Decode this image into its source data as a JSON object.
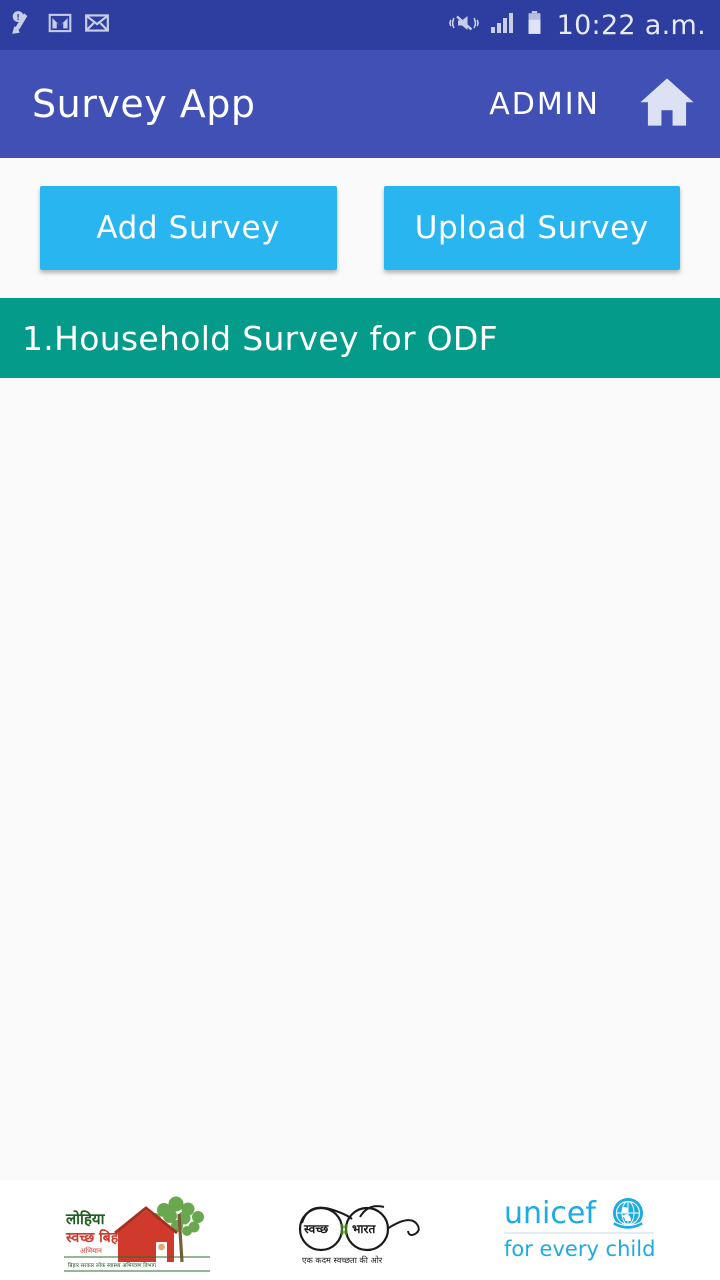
{
  "status_bar": {
    "background": "#2e3ea0",
    "clock": "10:22 a.m.",
    "left_icons": [
      {
        "name": "cleaner-alert-icon",
        "glyph": "broom-alert"
      },
      {
        "name": "gmail-icon",
        "glyph": "gmail"
      },
      {
        "name": "email-icon",
        "glyph": "envelope"
      }
    ],
    "right_icons": [
      {
        "name": "volume-mute-vibrate-icon",
        "glyph": "mute"
      },
      {
        "name": "signal-bars-icon",
        "glyph": "signal"
      },
      {
        "name": "battery-icon",
        "glyph": "battery"
      }
    ]
  },
  "app_bar": {
    "background": "#4050b5",
    "title": "Survey App",
    "user_role": "ADMIN",
    "home_icon_name": "home-icon"
  },
  "toolbar": {
    "add_survey_label": "Add Survey",
    "upload_survey_label": "Upload Survey",
    "button_color": "#29b6f0"
  },
  "survey_list": {
    "item_color": "#059b8a",
    "items": [
      {
        "label": "1.Household Survey for ODF"
      }
    ]
  },
  "footer": {
    "logos": [
      {
        "name": "lohiya-swachh-bihar-logo",
        "line1": "लोहिया",
        "line2": "स्वच्छ बिहार",
        "line3": "अभियान",
        "tagline": "बिहार सरकार लोक स्वास्थ्य अभियंत्रण विभाग",
        "color_primary": "#2d6e2d",
        "color_secondary": "#d2322d"
      },
      {
        "name": "swachh-bharat-logo",
        "lens_left": "स्वच्छ",
        "lens_right": "भारत",
        "tagline": "एक कदम स्वच्छता की ओर",
        "color_primary": "#1a1a1a"
      },
      {
        "name": "unicef-logo",
        "wordmark": "unicef",
        "tagline": "for every child",
        "color_primary": "#1cabe2"
      }
    ]
  }
}
